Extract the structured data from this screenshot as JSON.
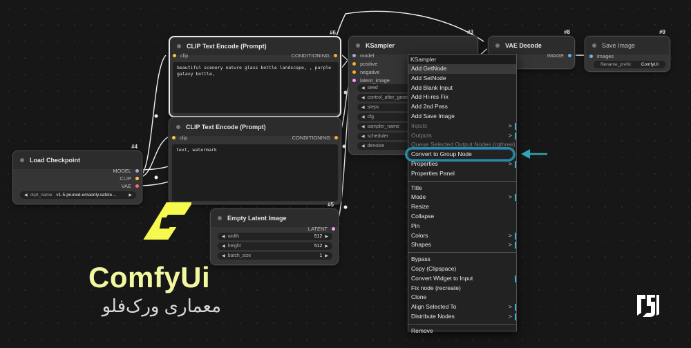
{
  "nodes": {
    "clip1": {
      "id": "#6",
      "title": "CLIP Text Encode (Prompt)",
      "in_clip": "clip",
      "out_cond": "CONDITIONING",
      "text": "beautiful scenery nature glass bottle landscape, , purple galaxy bottle,"
    },
    "clip2": {
      "title": "CLIP Text Encode (Prompt)",
      "in_clip": "clip",
      "out_cond": "CONDITIONING",
      "text": "text, watermark"
    },
    "ksampler": {
      "id": "#3",
      "title": "KSampler",
      "inputs": [
        "model",
        "positive",
        "negative",
        "latent_image"
      ],
      "widgets": [
        "seed",
        "control_after_generate",
        "steps",
        "cfg",
        "sampler_name",
        "scheduler",
        "denoise"
      ]
    },
    "vae_decode": {
      "id": "#8",
      "title": "VAE Decode",
      "out_image": "IMAGE"
    },
    "save_image": {
      "id": "#9",
      "title": "Save Image",
      "in_images": "images",
      "widget_label": "filename_prefix",
      "widget_value": "ComfyUI"
    },
    "checkpoint": {
      "id": "#4",
      "title": "Load Checkpoint",
      "outputs": [
        "MODEL",
        "CLIP",
        "VAE"
      ],
      "widget_label": "ckpt_name",
      "widget_value": "v1-5-pruned-emaonly.safete…"
    },
    "latent": {
      "id": "#5",
      "title": "Empty Latent Image",
      "out_latent": "LATENT",
      "widgets": [
        {
          "label": "width",
          "value": "512"
        },
        {
          "label": "height",
          "value": "512"
        },
        {
          "label": "batch_size",
          "value": "1"
        }
      ]
    }
  },
  "context_menu": {
    "title": "KSampler",
    "items": [
      {
        "label": "Add GetNode"
      },
      {
        "label": "Add SetNode"
      },
      {
        "label": "Add Blank Input"
      },
      {
        "label": "Add Hi-res Fix"
      },
      {
        "label": "Add 2nd Pass"
      },
      {
        "label": "Add Save Image"
      },
      {
        "label": "Inputs"
      },
      {
        "label": "Outputs"
      },
      {
        "label": "Queue Selected Output Nodes (rgthree)"
      },
      {
        "label": "Convert to Group Node"
      },
      {
        "label": "Properties"
      },
      {
        "label": "Properties Panel"
      },
      {
        "label": "Title"
      },
      {
        "label": "Mode"
      },
      {
        "label": "Resize"
      },
      {
        "label": "Collapse"
      },
      {
        "label": "Pin"
      },
      {
        "label": "Colors"
      },
      {
        "label": "Shapes"
      },
      {
        "label": "Bypass"
      },
      {
        "label": "Copy (Clipspace)"
      },
      {
        "label": "Convert Widget to Input"
      },
      {
        "label": "Fix node (recreate)"
      },
      {
        "label": "Clone"
      },
      {
        "label": "Align Selected To"
      },
      {
        "label": "Distribute Nodes"
      },
      {
        "label": "Remove"
      }
    ],
    "submenu_glyph": ">"
  },
  "brand": {
    "name": "ComfyUi",
    "subtitle": "معماری ورک‌فلو"
  },
  "colors": {
    "brand_yellow": "#f2f7a0",
    "logo_yellow": "#f6fa4e",
    "highlight_ring": "#2c8a9c",
    "arrow": "#2fa6b8"
  }
}
